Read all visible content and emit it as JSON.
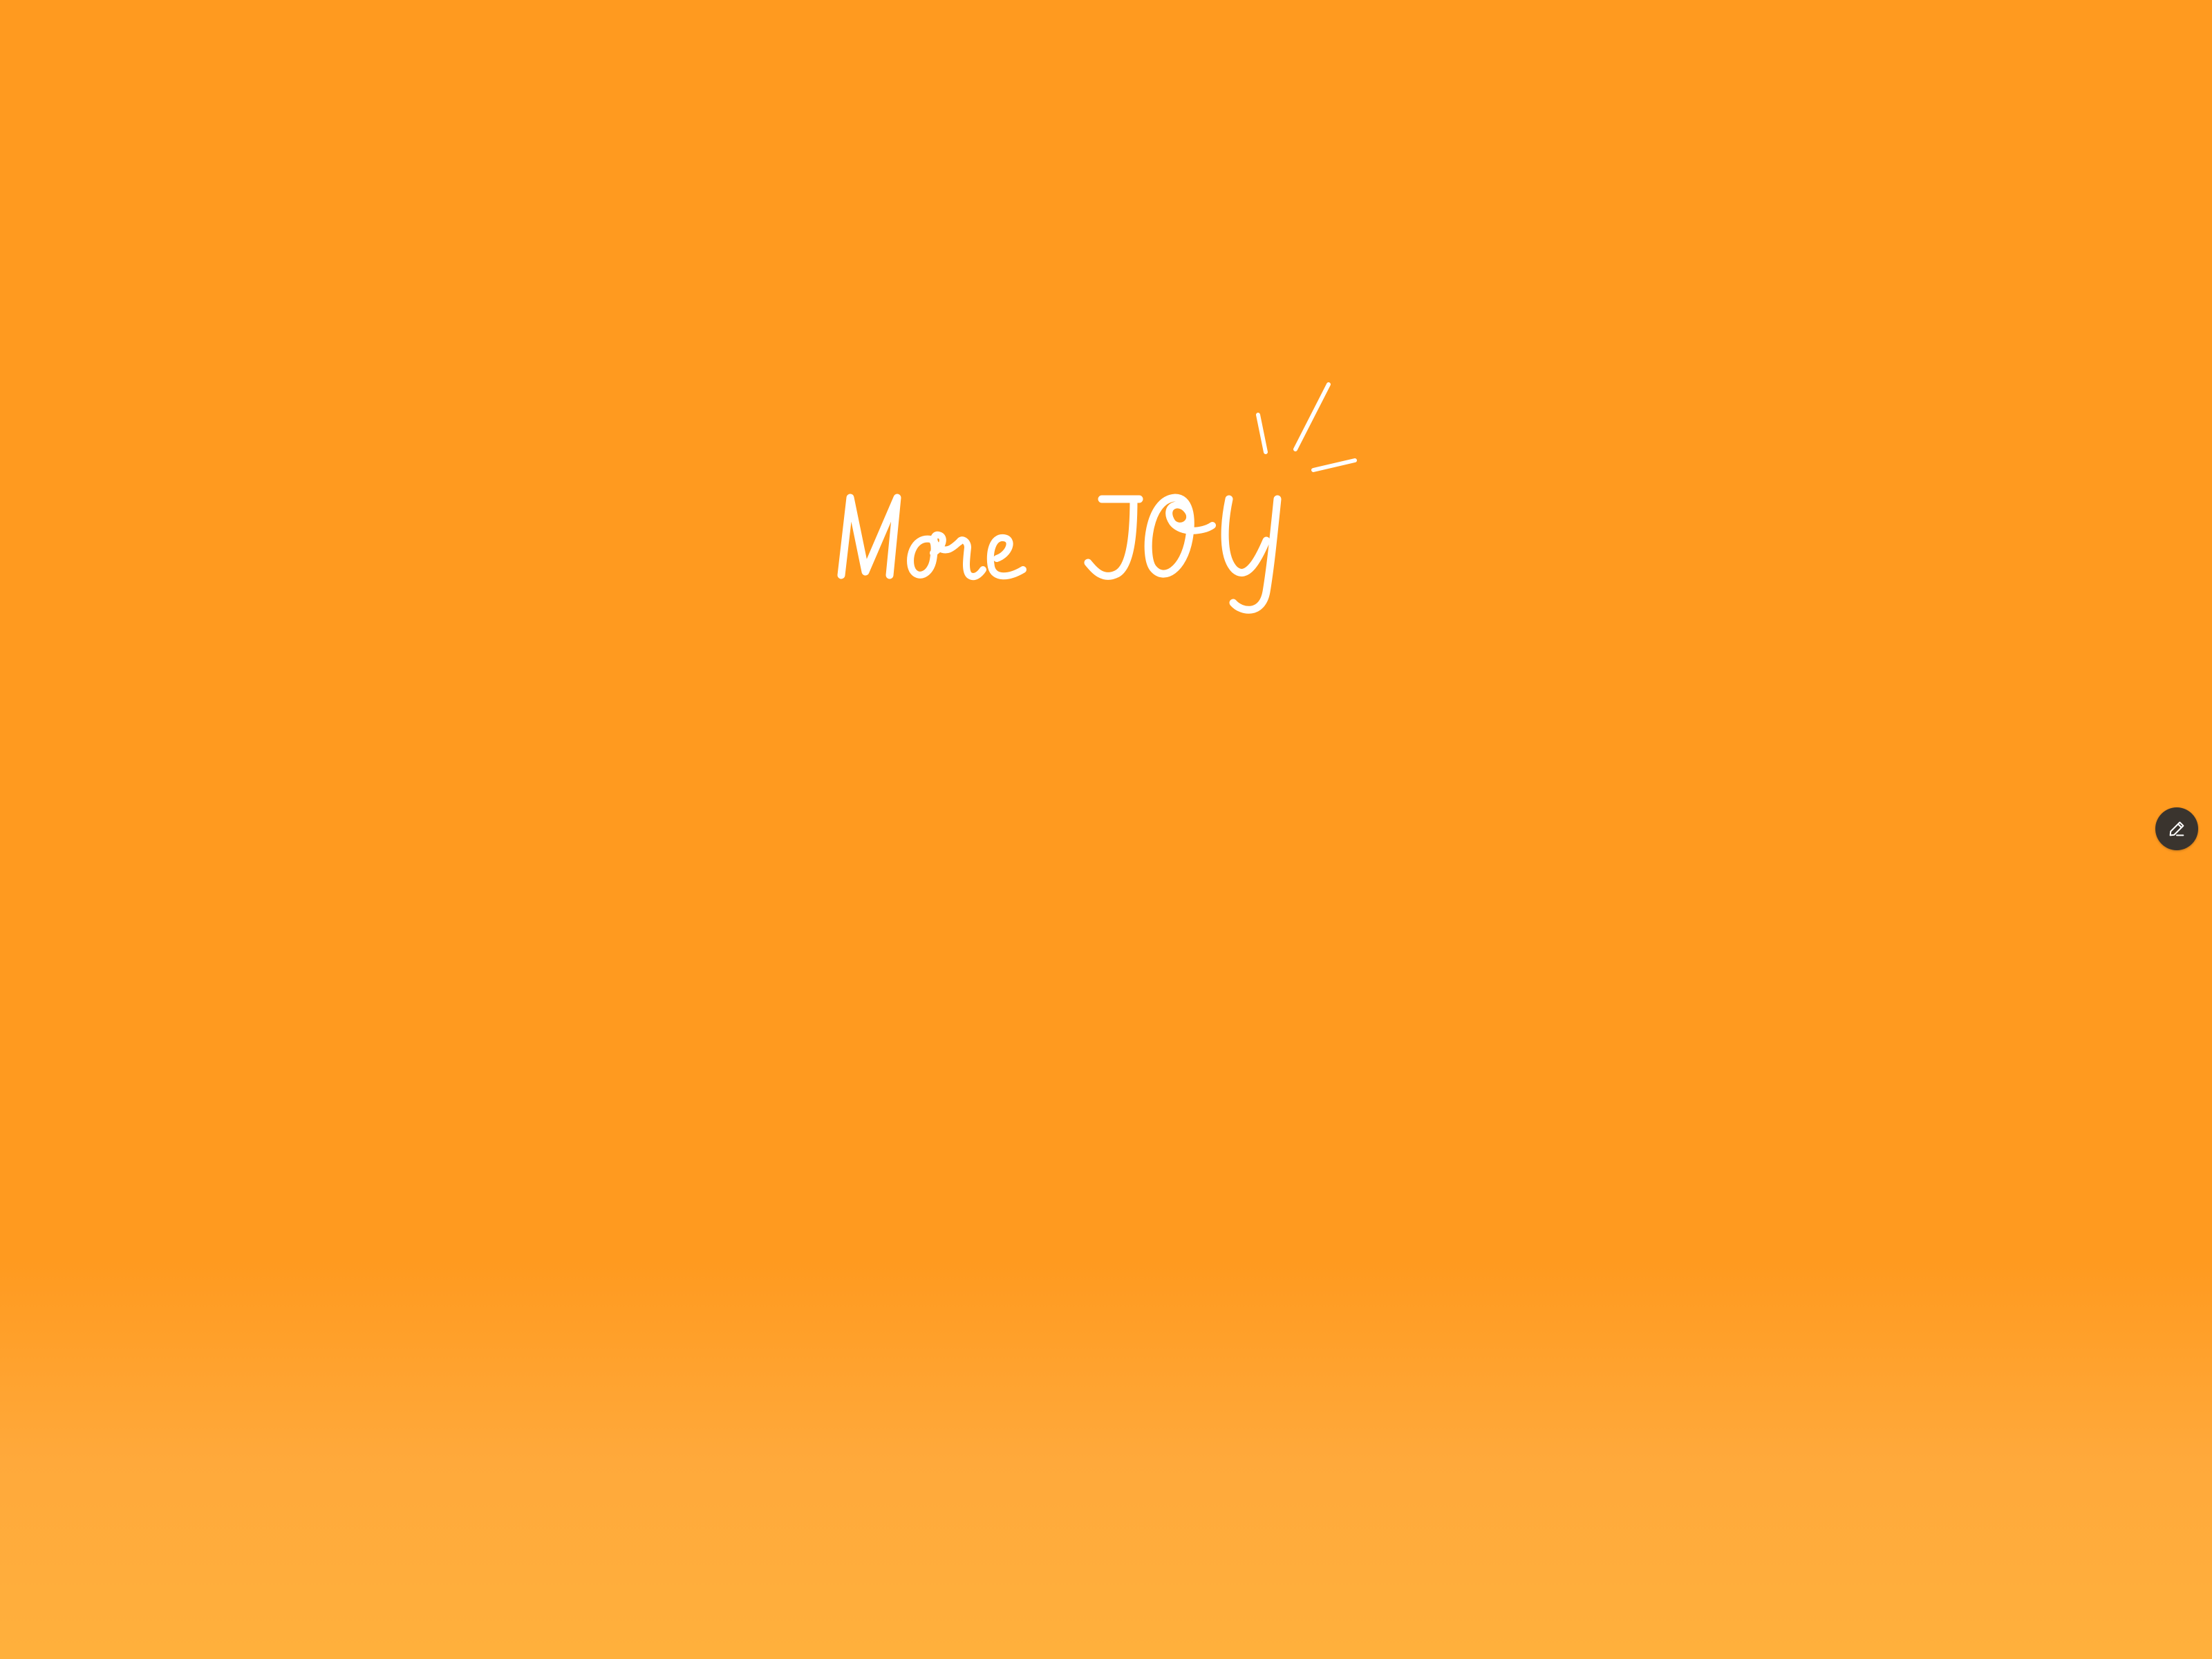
{
  "canvas": {
    "background_top": "#ff9a1f",
    "background_bottom": "#ffb03c",
    "headline": "More JOY",
    "headline_color": "#ffffff"
  },
  "toolbar": {
    "edit_icon": "pencil-edit-icon",
    "edit_button_color": "#3a342e"
  }
}
